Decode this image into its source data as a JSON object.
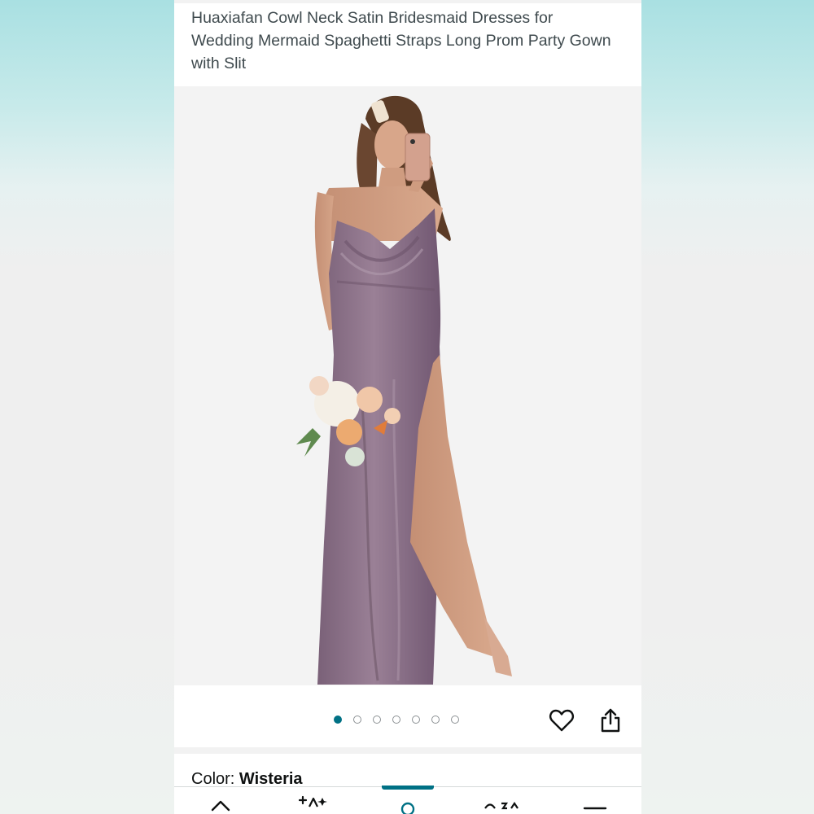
{
  "product": {
    "title": "Huaxiafan Cowl Neck Satin Bridesmaid Dresses for Wedding Mermaid Spaghetti Straps Long Prom Party Gown with Slit"
  },
  "gallery": {
    "image_icon": "product-photo",
    "dot_count": 7,
    "active_index": 0
  },
  "actions": {
    "favorite_icon": "heart-icon",
    "share_icon": "share-icon"
  },
  "color": {
    "label": "Color:",
    "value": "Wisteria"
  },
  "bottom_nav": {
    "items": [
      "home-icon",
      "ai-sparkle-icon",
      "profile-icon",
      "menu-icon",
      "more-icon"
    ],
    "active_index": 2
  },
  "colors": {
    "accent": "#007185",
    "dress": "#8a7187",
    "text": "#0f1111"
  }
}
